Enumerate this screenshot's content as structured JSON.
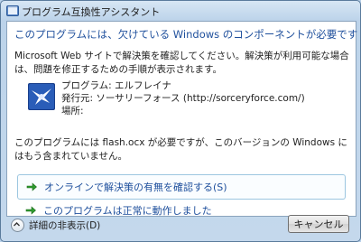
{
  "window": {
    "title": "プログラム互換性アシスタント"
  },
  "main": {
    "header": "このプログラムには、欠けている Windows のコンポーネントが必要です",
    "description": "Microsoft Web サイトで解決策を確認してください。解決策が利用可能な場合は、問題を修正するための手順が表示されます。",
    "program_line": "プログラム: エルフレイナ",
    "publisher_line": "発行元: ソーサリーフォース (http://sorceryforce.com/)",
    "location_line": "場所:",
    "message": "このプログラムには flash.ocx が必要ですが、このバージョンの Windows にはもう含まれていません。"
  },
  "options": [
    {
      "label": "オンラインで解決策の有無を確認する(S)",
      "icon": "green-arrow-icon"
    },
    {
      "label": "このプログラムは正常に動作しました",
      "icon": "green-arrow-icon"
    }
  ],
  "footer": {
    "details_label": "詳細の非表示(D)",
    "cancel_label": "キャンセル"
  },
  "colors": {
    "header_text": "#1e4f9c",
    "arrow_green": "#2e9a2e"
  }
}
